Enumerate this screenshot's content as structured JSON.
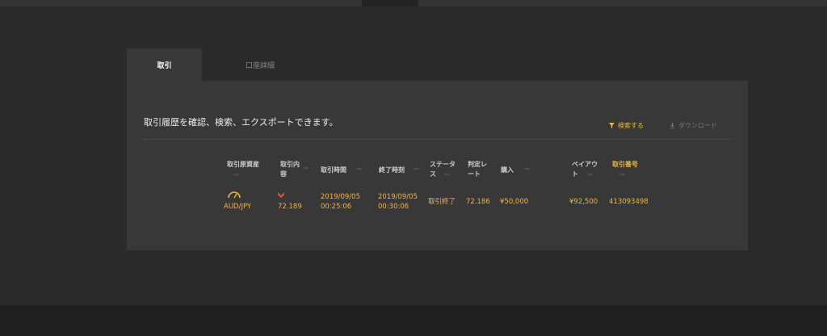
{
  "tabs": [
    "取引",
    "口座詳細"
  ],
  "description": "取引履歴を確認、検索、エクスポートできます。",
  "actions": {
    "search": "検索する",
    "download": "ダウンロード"
  },
  "table": {
    "headers": {
      "asset_l1": "取引原資産",
      "content_l1": "取引内",
      "content_l2": "容",
      "time": "取引時間",
      "end_time": "終了時刻",
      "status_l1": "ステータ",
      "status_l2": "ス",
      "rate_l1": "判定レ",
      "rate_l2": "ート",
      "purchase": "購入",
      "payout_l1": "ペイアウ",
      "payout_l2": "ト",
      "number": "取引番号"
    },
    "row": {
      "asset": "AUD/JPY",
      "content": "72.189",
      "time_date": "2019/09/05",
      "time_clock": "00:25:06",
      "end_date": "2019/09/05",
      "end_clock": "00:30:06",
      "status": "取引終了",
      "rate": "72.186",
      "purchase": "¥50,000",
      "payout": "¥92,500",
      "number": "413093498"
    }
  },
  "colors": {
    "accent": "#f0b43a",
    "down": "#e0504a"
  }
}
